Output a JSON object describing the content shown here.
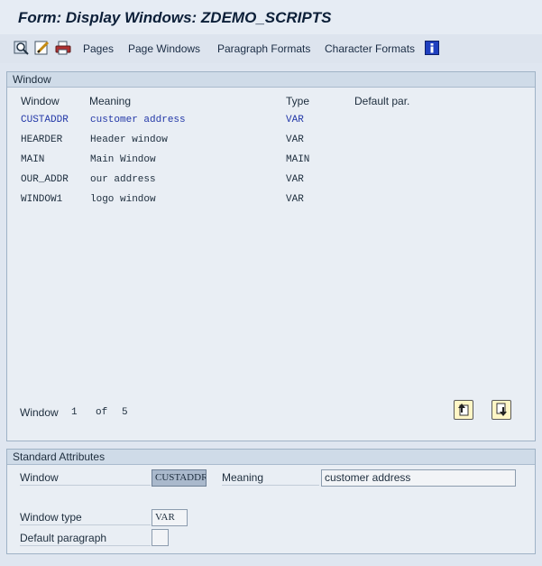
{
  "title": "Form: Display Windows: ZDEMO_SCRIPTS",
  "toolbar": {
    "links": [
      "Pages",
      "Page Windows",
      "Paragraph Formats",
      "Character Formats"
    ]
  },
  "window_group": {
    "title": "Window",
    "columns": [
      "Window",
      "Meaning",
      "Type",
      "Default par."
    ],
    "rows": [
      {
        "window": "CUSTADDR",
        "meaning": "customer address",
        "type": "VAR",
        "selected": true
      },
      {
        "window": "HEARDER",
        "meaning": "Header window",
        "type": "VAR"
      },
      {
        "window": "MAIN",
        "meaning": "Main Window",
        "type": "MAIN"
      },
      {
        "window": "OUR_ADDR",
        "meaning": "our address",
        "type": "VAR"
      },
      {
        "window": "WINDOW1",
        "meaning": "logo window",
        "type": "VAR"
      }
    ],
    "pager": {
      "label": "Window",
      "current": "1",
      "of_label": "of",
      "total": "5"
    }
  },
  "attrs_group": {
    "title": "Standard Attributes",
    "window_label": "Window",
    "window_value": "CUSTADDR",
    "meaning_label": "Meaning",
    "meaning_value": "customer address",
    "window_type_label": "Window type",
    "window_type_value": "VAR",
    "default_paragraph_label": "Default paragraph",
    "default_paragraph_value": ""
  },
  "colors": {
    "selected_row_text": "#2338a8",
    "nav_button_bg": "#fff6c6",
    "info_icon": "#1f3fbf"
  }
}
